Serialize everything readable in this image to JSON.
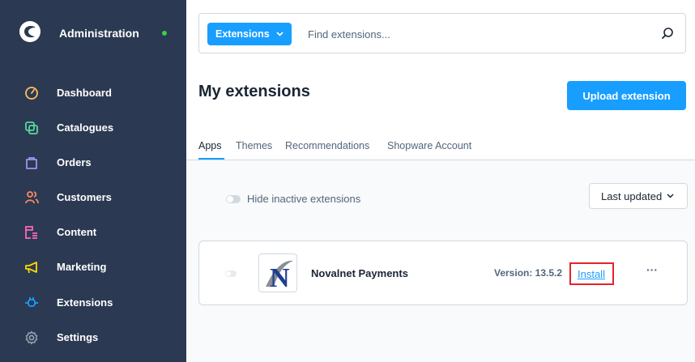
{
  "sidebar": {
    "brand_title": "Administration",
    "status_color": "#37d046",
    "items": [
      {
        "label": "Dashboard",
        "icon": "gauge-icon",
        "color": "#ffbd5d"
      },
      {
        "label": "Catalogues",
        "icon": "catalog-icon",
        "color": "#57d9a3"
      },
      {
        "label": "Orders",
        "icon": "shopping-bag-icon",
        "color": "#a092f0"
      },
      {
        "label": "Customers",
        "icon": "users-icon",
        "color": "#f88962"
      },
      {
        "label": "Content",
        "icon": "content-icon",
        "color": "#ff68b4"
      },
      {
        "label": "Marketing",
        "icon": "megaphone-icon",
        "color": "#ffd700"
      },
      {
        "label": "Extensions",
        "icon": "plug-icon",
        "color": "#189eff"
      },
      {
        "label": "Settings",
        "icon": "gear-icon",
        "color": "#9aa8b5"
      }
    ]
  },
  "search": {
    "type_label": "Extensions",
    "placeholder": "Find extensions..."
  },
  "header": {
    "title": "My extensions",
    "upload_label": "Upload extension"
  },
  "tabs": [
    {
      "label": "Apps",
      "active": true
    },
    {
      "label": "Themes",
      "active": false
    },
    {
      "label": "Recommendations",
      "active": false
    },
    {
      "label": "Shopware Account",
      "active": false
    }
  ],
  "filters": {
    "hide_inactive_label": "Hide inactive extensions",
    "sort_label": "Last updated"
  },
  "extension": {
    "name": "Novalnet Payments",
    "version": "Version: 13.5.2",
    "install_label": "Install",
    "more_label": "···",
    "logo_letter": "N"
  },
  "colors": {
    "accent": "#189eff",
    "sidebar_bg": "#2b3a52",
    "highlight_border": "#e3242b"
  }
}
